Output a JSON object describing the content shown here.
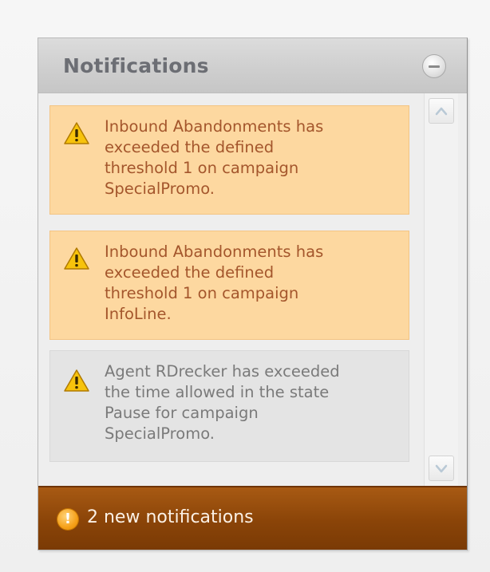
{
  "panel": {
    "title": "Notifications",
    "collapse_icon": "minus-circle-icon"
  },
  "notifications": [
    {
      "severity": "warning",
      "icon": "warning-triangle-icon",
      "text": "Inbound Abandonments has\nexceeded the defined\nthreshold 1 on campaign\nSpecialPromo."
    },
    {
      "severity": "warning",
      "icon": "warning-triangle-icon",
      "text": "Inbound Abandonments has\nexceeded the defined\nthreshold 1 on campaign\nInfoLine."
    },
    {
      "severity": "info",
      "icon": "warning-triangle-icon",
      "text": "Agent RDrecker has exceeded\nthe time allowed in the state\nPause for campaign\nSpecialPromo."
    }
  ],
  "scrollbar": {
    "up_icon": "chevron-up-icon",
    "down_icon": "chevron-down-icon"
  },
  "footer": {
    "icon": "exclamation-circle-icon",
    "label": "2 new notifications"
  },
  "colors": {
    "warning_bg": "#fdd8a0",
    "warning_text": "#a4562c",
    "info_bg": "#e4e4e4",
    "footer_bg": "#8a4408"
  }
}
